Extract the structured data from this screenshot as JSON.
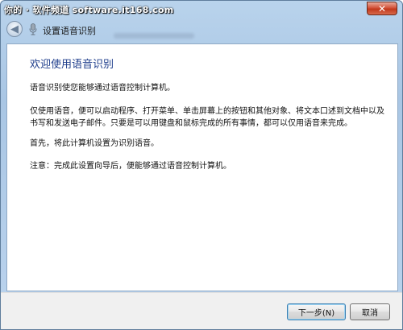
{
  "window": {
    "watermark": "你的 · 软件频道 software.it168.com",
    "close_symbol": "✕",
    "nav_title": "设置语音识别",
    "back_symbol": "◀"
  },
  "content": {
    "heading": "欢迎使用语音识别",
    "paragraphs": [
      "语音识别使您能够通过语音控制计算机。",
      "仅使用语音，便可以启动程序、打开菜单、单击屏幕上的按钮和其他对象、将文本口述到文档中以及书写和发送电子邮件。只要是可以用键盘和鼠标完成的所有事情，都可以仅用语音来完成。",
      "首先，将此计算机设置为识别语音。",
      "注意：完成此设置向导后，便能够通过语音控制计算机。"
    ]
  },
  "buttons": {
    "next": "下一步(N)",
    "cancel": "取消"
  }
}
